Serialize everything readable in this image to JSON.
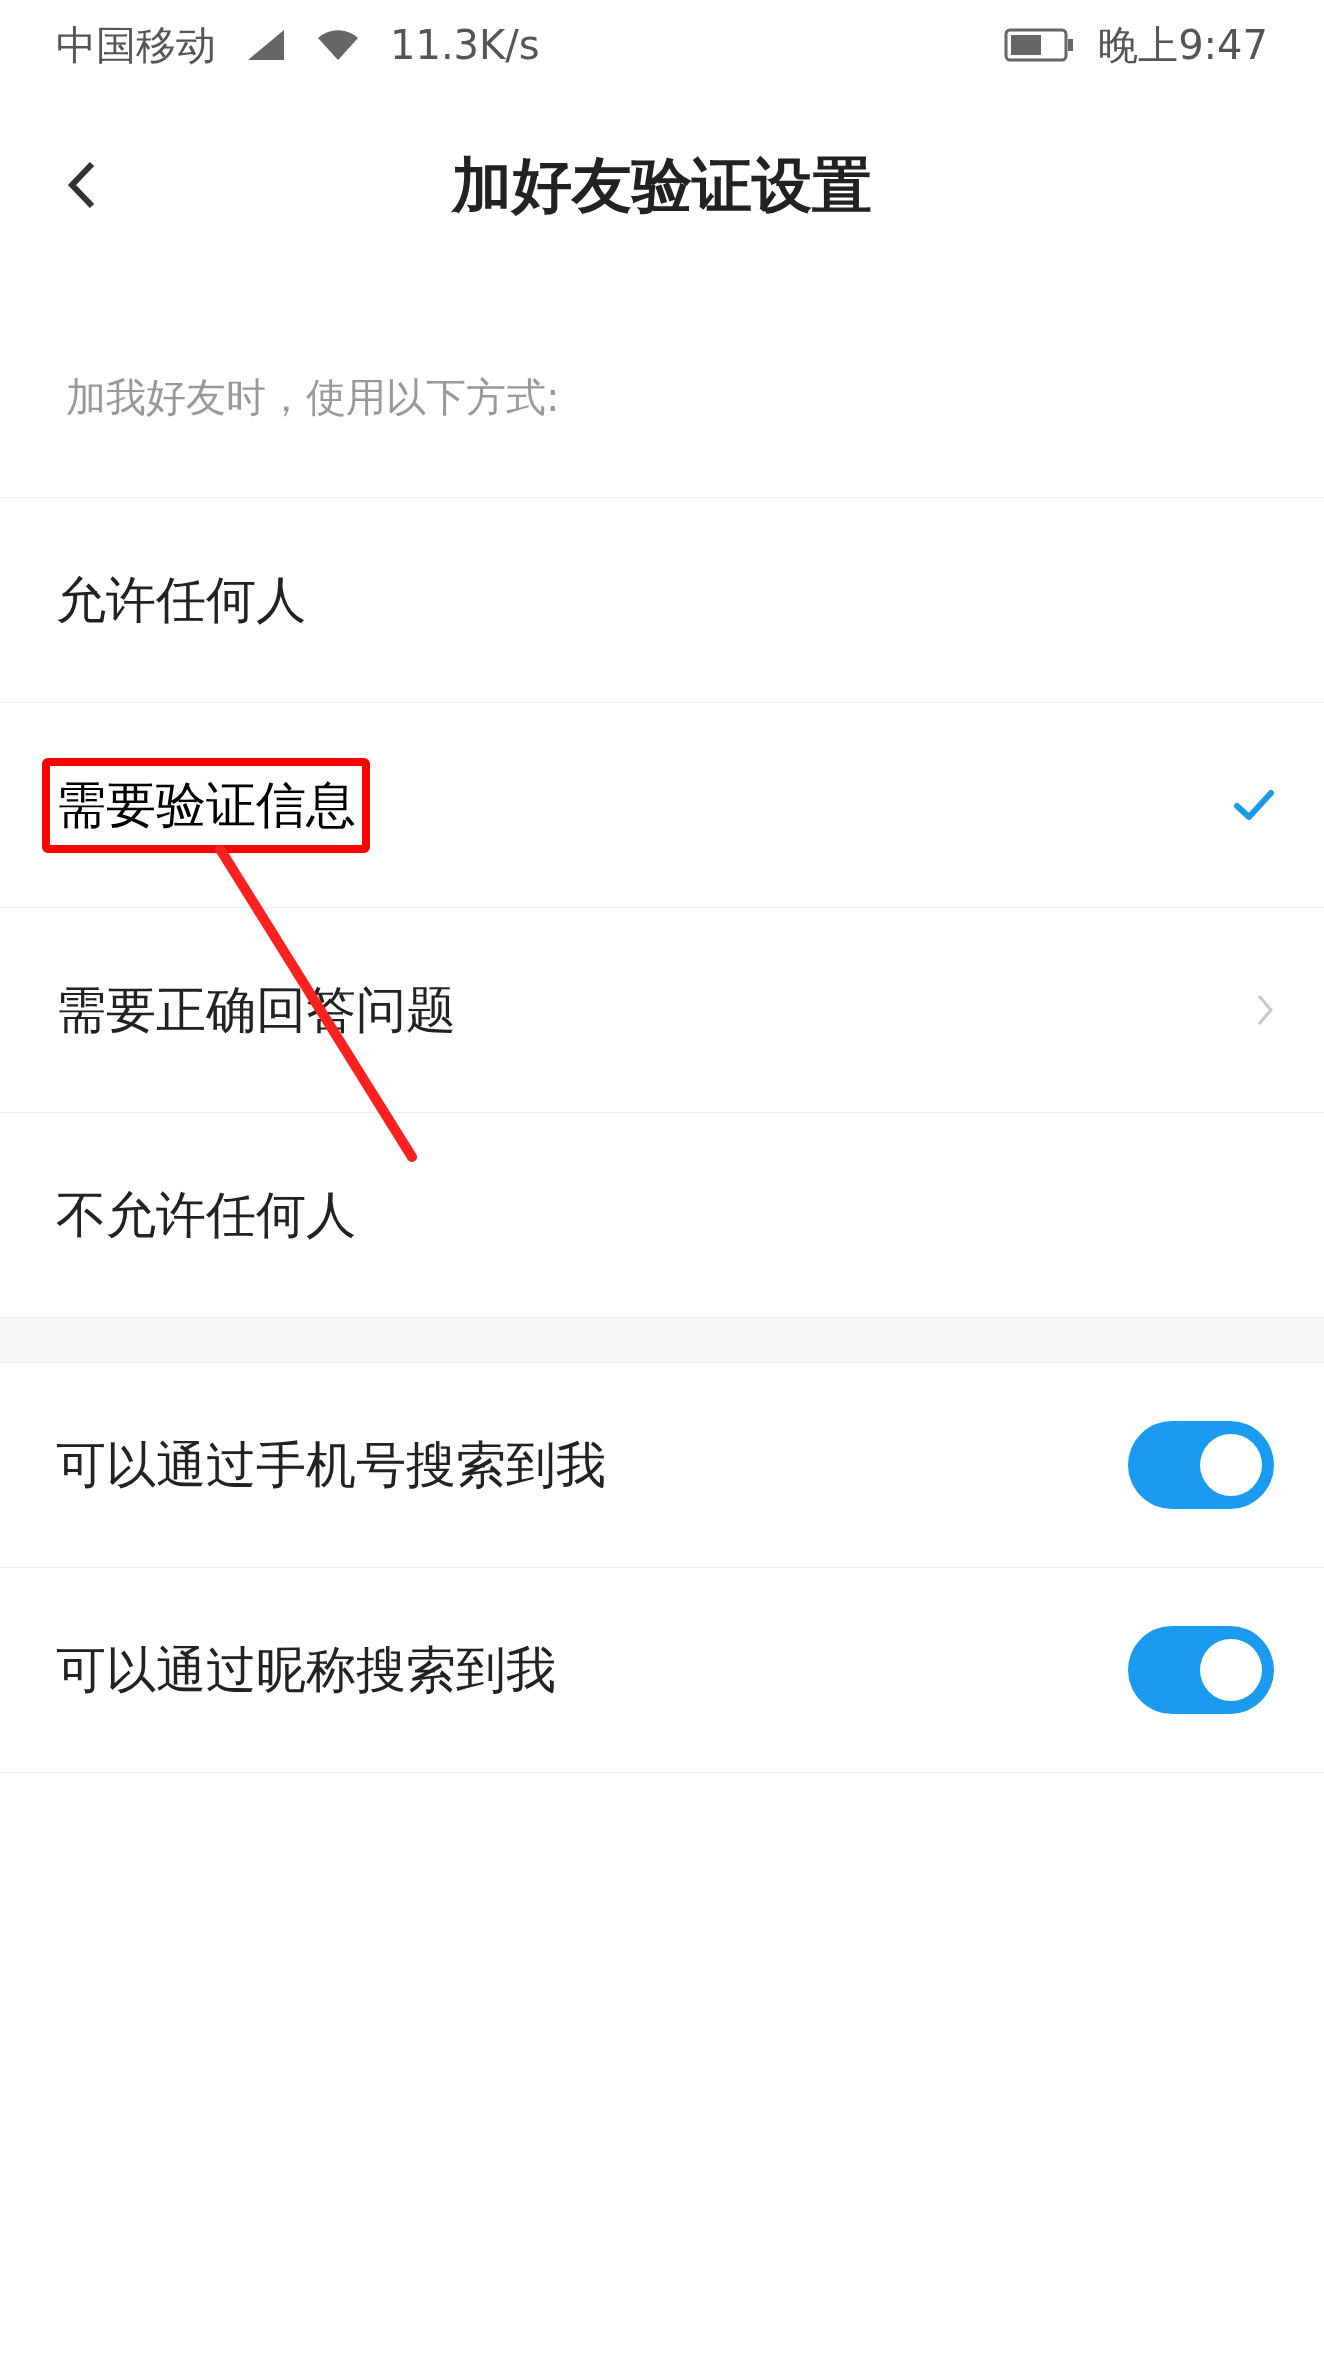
{
  "status_bar": {
    "carrier": "中国移动",
    "speed": "11.3K/s",
    "time": "晚上9:47"
  },
  "header": {
    "title": "加好友验证设置"
  },
  "section_hint": "加我好友时，使用以下方式:",
  "options": [
    {
      "kind": "option",
      "label": "允许任何人",
      "selected": false,
      "highlighted": false
    },
    {
      "kind": "option",
      "label": "需要验证信息",
      "selected": true,
      "highlighted": true
    },
    {
      "kind": "link",
      "label": "需要正确回答问题",
      "selected": false,
      "highlighted": false
    },
    {
      "kind": "option",
      "label": "不允许任何人",
      "selected": false,
      "highlighted": false
    }
  ],
  "toggles": [
    {
      "kind": "toggle",
      "label": "可以通过手机号搜索到我",
      "on": true
    },
    {
      "kind": "toggle",
      "label": "可以通过昵称搜索到我",
      "on": true
    }
  ]
}
